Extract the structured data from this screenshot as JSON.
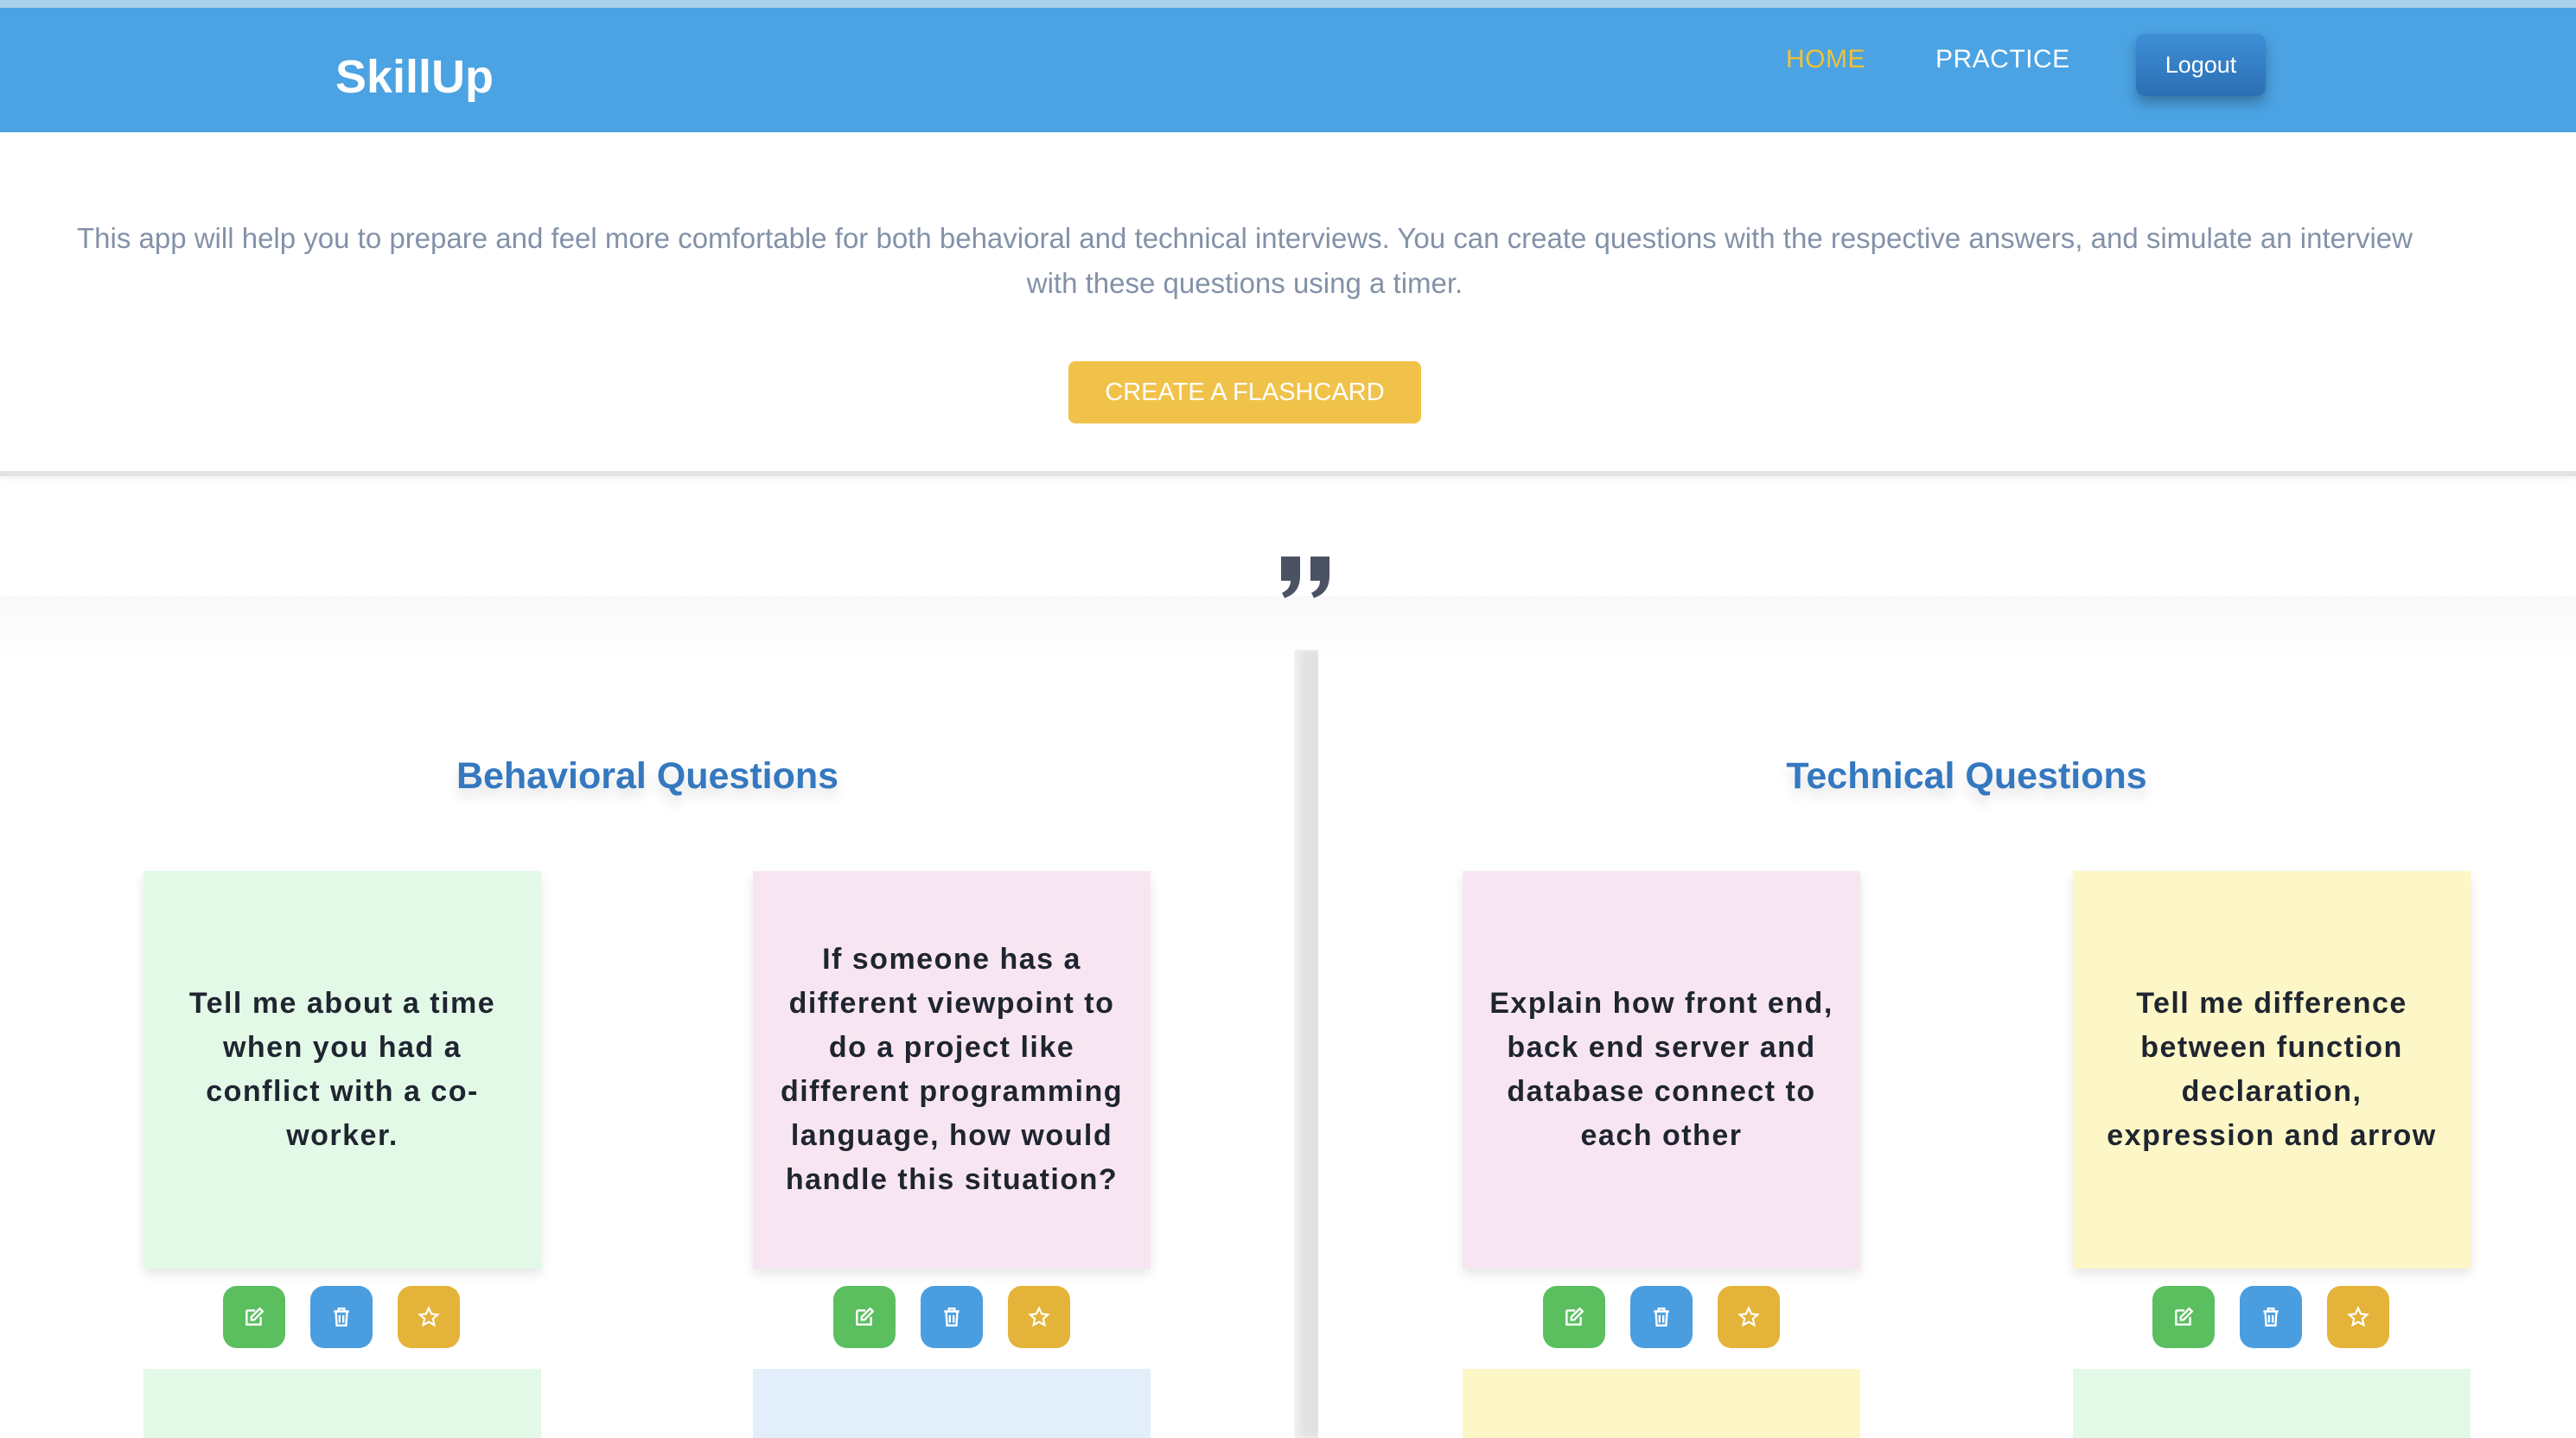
{
  "navbar": {
    "brand": "SkillUp",
    "links": [
      {
        "label": "HOME",
        "active": true
      },
      {
        "label": "PRACTICE",
        "active": false
      }
    ],
    "logout_label": "Logout"
  },
  "intro": {
    "text": "This app will help you to prepare and feel more comfortable for both behavioral and technical interviews. You can create questions with the respective answers, and simulate an interview with these questions using a timer.",
    "create_button_label": "CREATE A FLASHCARD"
  },
  "sections": [
    {
      "title": "Behavioral Questions",
      "cards": [
        {
          "question": "Tell me about a time when you had a conflict with a co-worker.",
          "color": "#e3f9e7"
        },
        {
          "question": "If someone has a different viewpoint to do a project like different programming language, how would handle this situation?",
          "color": "#f7e6f1"
        }
      ],
      "next_row_colors": [
        "#e3f9e7",
        "#e3eefb"
      ]
    },
    {
      "title": "Technical Questions",
      "cards": [
        {
          "question": "Explain how front end, back end server and database connect to each other",
          "color": "#f7e6f1"
        },
        {
          "question": "Tell me difference between function declaration, expression and arrow",
          "color": "#fdf7c7"
        }
      ],
      "next_row_colors": [
        "#fdf7c7",
        "#e3f9e7"
      ]
    }
  ],
  "card_actions": [
    {
      "name": "edit",
      "icon": "edit-icon",
      "color": "#5bbf5f"
    },
    {
      "name": "delete",
      "icon": "trash-icon",
      "color": "#4a9ee0"
    },
    {
      "name": "favorite",
      "icon": "star-icon",
      "color": "#e4b33a"
    }
  ],
  "colors": {
    "navbar": "#4ba3e3",
    "accent": "#f1c232",
    "section_title": "#3478c0"
  }
}
